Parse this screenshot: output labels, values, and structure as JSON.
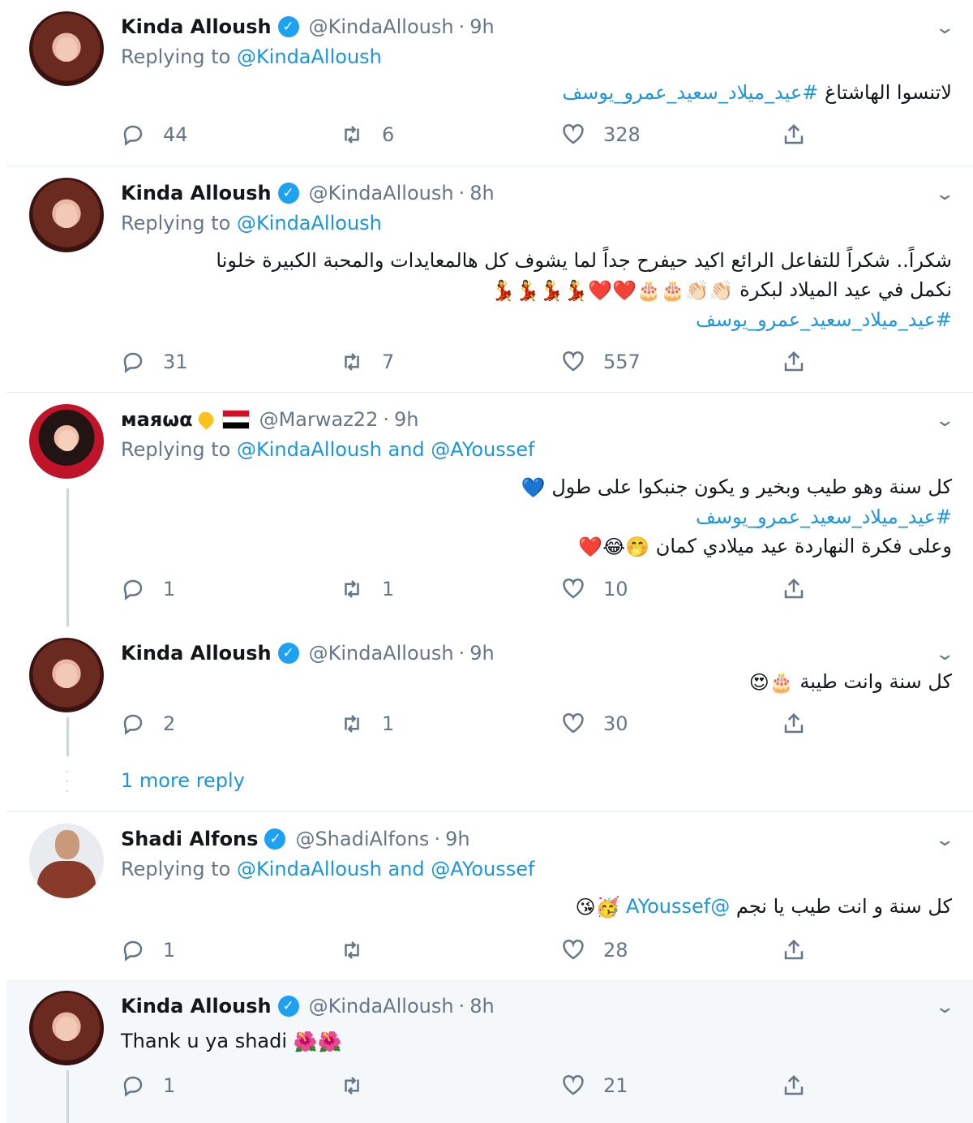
{
  "tweets": [
    {
      "name": "Kinda Alloush",
      "handle": "@KindaAlloush",
      "time": "9h",
      "replying_prefix": "Replying to",
      "replying_to": "@KindaAlloush",
      "text_plain": "لاتنسوا الهاشتاغ",
      "hashtag": "#عيد_ميلاد_سعيد_عمرو_يوسف",
      "replies": "44",
      "retweets": "6",
      "likes": "328"
    },
    {
      "name": "Kinda Alloush",
      "handle": "@KindaAlloush",
      "time": "8h",
      "replying_prefix": "Replying to",
      "replying_to": "@KindaAlloush",
      "line1": "شكراً.. شكراً للتفاعل الرائع اكيد حيفرح جداً لما يشوف كل هالمعايدات والمحبة الكبيرة خلونا",
      "line2": "نكمل في عيد الميلاد لبكرة",
      "line2_emoji": "👏🏻👏🏻🎂🎂❤️❤️💃💃💃💃",
      "hashtag": "#عيد_ميلاد_سعيد_عمرو_يوسف",
      "replies": "31",
      "retweets": "7",
      "likes": "557"
    },
    {
      "name": "маяωα",
      "handle": "@Marwaz22",
      "time": "9h",
      "replying_prefix": "Replying to",
      "replying_to": "@KindaAlloush and @AYoussef",
      "line1": "كل سنة وهو طيب وبخير و يكون جنبكوا على طول",
      "line1_emoji": "💙",
      "hashtag": "#عيد_ميلاد_سعيد_عمرو_يوسف",
      "line3": "وعلى فكرة النهاردة عيد ميلادي كمان",
      "line3_emoji": "🤭😂❤️",
      "replies": "1",
      "retweets": "1",
      "likes": "10"
    },
    {
      "name": "Kinda Alloush",
      "handle": "@KindaAlloush",
      "time": "9h",
      "line1": "كل سنة وانت طيبة",
      "line1_emoji": "🎂😍",
      "replies": "2",
      "retweets": "1",
      "likes": "30"
    },
    {
      "name": "Shadi Alfons",
      "handle": "@ShadiAlfons",
      "time": "9h",
      "replying_prefix": "Replying to",
      "replying_to": "@KindaAlloush and @AYoussef",
      "line1": "كل سنة و انت طيب يا نجم",
      "mention": "@AYoussef",
      "line1_emoji": "🥳😘",
      "replies": "1",
      "retweets": "",
      "likes": "28"
    },
    {
      "name": "Kinda Alloush",
      "handle": "@KindaAlloush",
      "time": "8h",
      "line1": "Thank u ya shadi",
      "line1_emoji": "🌺🌺",
      "replies": "1",
      "retweets": "",
      "likes": "21"
    }
  ],
  "more_replies": "1 more reply",
  "separator": "·",
  "verified_mark": "✓",
  "chevron": "⌄",
  "colors": {
    "link": "#1b95e0",
    "verified": "#1da1f2",
    "muted": "#657786",
    "border": "#e6ecf0",
    "highlight_bg": "#f5f8fa"
  },
  "icons": {
    "reply": "reply-icon",
    "retweet": "retweet-icon",
    "like": "heart-icon",
    "share": "share-icon",
    "menu": "chevron-down-icon"
  }
}
